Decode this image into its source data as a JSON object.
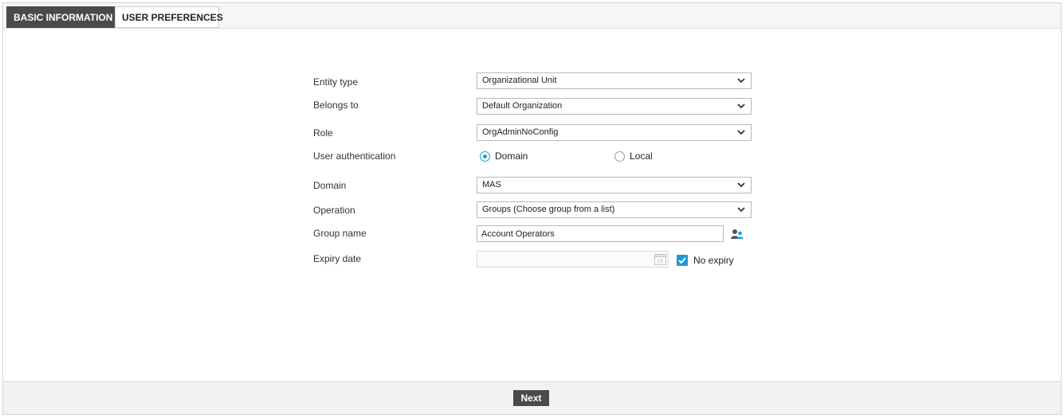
{
  "tabs": [
    {
      "label": "BASIC INFORMATION",
      "active": true
    },
    {
      "label": "USER PREFERENCES",
      "active": false
    }
  ],
  "form": {
    "entity_type": {
      "label": "Entity type",
      "value": "Organizational Unit"
    },
    "belongs_to": {
      "label": "Belongs to",
      "value": "Default Organization"
    },
    "role": {
      "label": "Role",
      "value": "OrgAdminNoConfig"
    },
    "user_authentication": {
      "label": "User authentication",
      "options": [
        {
          "label": "Domain",
          "selected": true
        },
        {
          "label": "Local",
          "selected": false
        }
      ]
    },
    "domain": {
      "label": "Domain",
      "value": "MAS"
    },
    "operation": {
      "label": "Operation",
      "value": "Groups (Choose group from a list)"
    },
    "group_name": {
      "label": "Group name",
      "value": "Account Operators",
      "icon": "group-select-icon"
    },
    "expiry_date": {
      "label": "Expiry date",
      "value": "",
      "icon": "calendar-icon",
      "calendar_day": "15"
    },
    "no_expiry": {
      "label": "No expiry",
      "checked": true
    }
  },
  "footer": {
    "next_label": "Next"
  },
  "colors": {
    "accent": "#1a9bd7",
    "tab_active_bg": "#4a4a4a",
    "button_bg": "#4a4a4a"
  }
}
